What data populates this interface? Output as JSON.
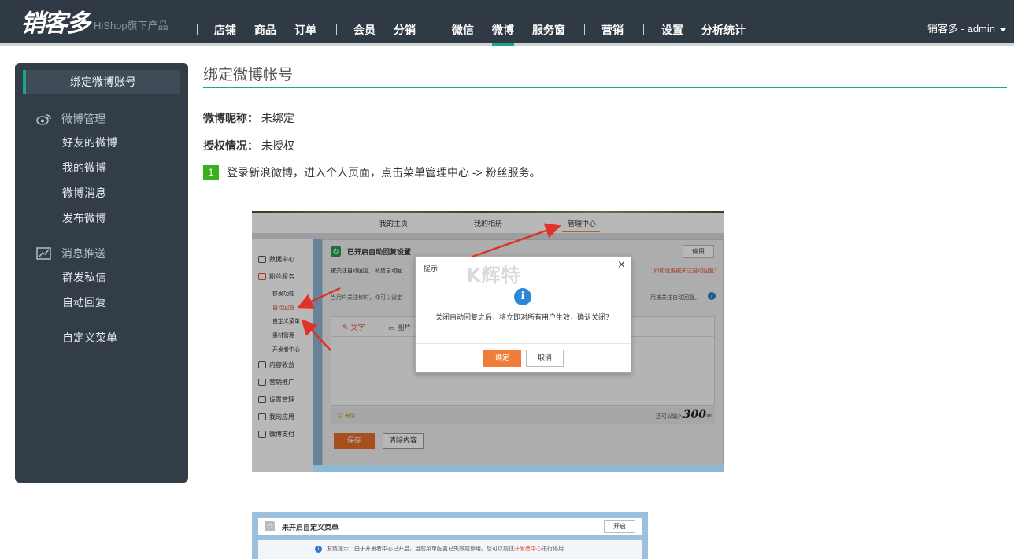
{
  "header": {
    "logo_text": "销客多",
    "logo_sub": "HiShop旗下产品",
    "nav": [
      {
        "label": "店铺"
      },
      {
        "label": "商品"
      },
      {
        "label": "订单"
      },
      {
        "label": "会员"
      },
      {
        "label": "分销"
      },
      {
        "label": "微信"
      },
      {
        "label": "微博"
      },
      {
        "label": "服务窗"
      },
      {
        "label": "营销"
      },
      {
        "label": "设置"
      },
      {
        "label": "分析统计"
      }
    ],
    "active_nav": "微博",
    "user": "销客多 - admin"
  },
  "sidebar": {
    "header": "绑定微博账号",
    "groups": [
      {
        "label": "微博管理",
        "icon": "weibo-icon",
        "items": [
          "好友的微博",
          "我的微博",
          "微博消息",
          "发布微博"
        ]
      },
      {
        "label": "消息推送",
        "icon": "chart-board-icon",
        "items": [
          "群发私信",
          "自动回复"
        ]
      }
    ],
    "extra": "自定义菜单"
  },
  "main": {
    "title": "绑定微博帐号",
    "nickname_label": "微博昵称：",
    "nickname_value": "未绑定",
    "auth_label": "授权情况：",
    "auth_value": "未授权",
    "step_num": "1",
    "step_text": "登录新浪微博，进入个人页面，点击菜单管理中心 -> 粉丝服务。"
  },
  "shot1": {
    "tabs": [
      "我的主页",
      "我的相册",
      "管理中心"
    ],
    "left_nav": [
      {
        "label": "数据中心"
      },
      {
        "label": "粉丝服务"
      },
      {
        "label": "内容收益"
      },
      {
        "label": "营销推广"
      },
      {
        "label": "设置管理"
      },
      {
        "label": "我的应用"
      },
      {
        "label": "微博支付"
      }
    ],
    "left_sub": [
      "群发功能",
      "自动回复",
      "自定义菜单",
      "素材管理",
      "开发者中心"
    ],
    "panel_title": "已开启自动回复设置",
    "stop_btn": "停用",
    "panel_tabs": "被关注自动回复　私信自动回",
    "panel_link": "如何设置被关注自动回复?",
    "panel_note": "当用户关注你时，你可以设定",
    "panel_note_right": "用被关注自动回复。",
    "editor_tab_text": "文字",
    "editor_tab_image": "图片",
    "emoji": "表情",
    "remain_prefix": "还可以输入",
    "remain_num": "300",
    "remain_suffix": "字",
    "save": "保存",
    "clear": "清除内容",
    "dialog_title": "提示",
    "dialog_close": "×",
    "dialog_msg": "关闭自动回复之后，将立即对所有用户生效，确认关闭？",
    "dialog_ok": "确定",
    "dialog_cancel": "取消",
    "watermark": "K辉特",
    "arrow_color": "#e0322a"
  },
  "shot2": {
    "title": "未开启自定义菜单",
    "open_btn": "开启",
    "tip_prefix": "友情提示：由于开发者中心已开启，当前菜单配置已失效或停用。您可以前往",
    "tip_link": "开发者中心",
    "tip_suffix": "进行停用"
  },
  "colors": {
    "topbar": "#2f3a44",
    "accent": "#1ca48e",
    "sidebar": "#323d48",
    "step_badge": "#38b01f"
  }
}
